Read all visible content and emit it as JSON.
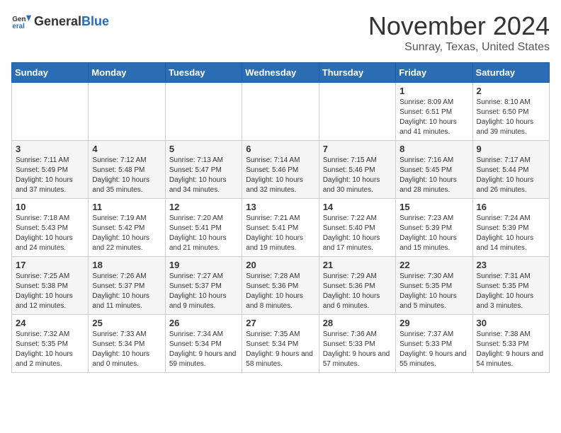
{
  "header": {
    "logo_general": "General",
    "logo_blue": "Blue",
    "month_title": "November 2024",
    "location": "Sunray, Texas, United States"
  },
  "days_of_week": [
    "Sunday",
    "Monday",
    "Tuesday",
    "Wednesday",
    "Thursday",
    "Friday",
    "Saturday"
  ],
  "weeks": [
    [
      {
        "day": "",
        "info": ""
      },
      {
        "day": "",
        "info": ""
      },
      {
        "day": "",
        "info": ""
      },
      {
        "day": "",
        "info": ""
      },
      {
        "day": "",
        "info": ""
      },
      {
        "day": "1",
        "info": "Sunrise: 8:09 AM\nSunset: 6:51 PM\nDaylight: 10 hours and 41 minutes."
      },
      {
        "day": "2",
        "info": "Sunrise: 8:10 AM\nSunset: 6:50 PM\nDaylight: 10 hours and 39 minutes."
      }
    ],
    [
      {
        "day": "3",
        "info": "Sunrise: 7:11 AM\nSunset: 5:49 PM\nDaylight: 10 hours and 37 minutes."
      },
      {
        "day": "4",
        "info": "Sunrise: 7:12 AM\nSunset: 5:48 PM\nDaylight: 10 hours and 35 minutes."
      },
      {
        "day": "5",
        "info": "Sunrise: 7:13 AM\nSunset: 5:47 PM\nDaylight: 10 hours and 34 minutes."
      },
      {
        "day": "6",
        "info": "Sunrise: 7:14 AM\nSunset: 5:46 PM\nDaylight: 10 hours and 32 minutes."
      },
      {
        "day": "7",
        "info": "Sunrise: 7:15 AM\nSunset: 5:46 PM\nDaylight: 10 hours and 30 minutes."
      },
      {
        "day": "8",
        "info": "Sunrise: 7:16 AM\nSunset: 5:45 PM\nDaylight: 10 hours and 28 minutes."
      },
      {
        "day": "9",
        "info": "Sunrise: 7:17 AM\nSunset: 5:44 PM\nDaylight: 10 hours and 26 minutes."
      }
    ],
    [
      {
        "day": "10",
        "info": "Sunrise: 7:18 AM\nSunset: 5:43 PM\nDaylight: 10 hours and 24 minutes."
      },
      {
        "day": "11",
        "info": "Sunrise: 7:19 AM\nSunset: 5:42 PM\nDaylight: 10 hours and 22 minutes."
      },
      {
        "day": "12",
        "info": "Sunrise: 7:20 AM\nSunset: 5:41 PM\nDaylight: 10 hours and 21 minutes."
      },
      {
        "day": "13",
        "info": "Sunrise: 7:21 AM\nSunset: 5:41 PM\nDaylight: 10 hours and 19 minutes."
      },
      {
        "day": "14",
        "info": "Sunrise: 7:22 AM\nSunset: 5:40 PM\nDaylight: 10 hours and 17 minutes."
      },
      {
        "day": "15",
        "info": "Sunrise: 7:23 AM\nSunset: 5:39 PM\nDaylight: 10 hours and 15 minutes."
      },
      {
        "day": "16",
        "info": "Sunrise: 7:24 AM\nSunset: 5:39 PM\nDaylight: 10 hours and 14 minutes."
      }
    ],
    [
      {
        "day": "17",
        "info": "Sunrise: 7:25 AM\nSunset: 5:38 PM\nDaylight: 10 hours and 12 minutes."
      },
      {
        "day": "18",
        "info": "Sunrise: 7:26 AM\nSunset: 5:37 PM\nDaylight: 10 hours and 11 minutes."
      },
      {
        "day": "19",
        "info": "Sunrise: 7:27 AM\nSunset: 5:37 PM\nDaylight: 10 hours and 9 minutes."
      },
      {
        "day": "20",
        "info": "Sunrise: 7:28 AM\nSunset: 5:36 PM\nDaylight: 10 hours and 8 minutes."
      },
      {
        "day": "21",
        "info": "Sunrise: 7:29 AM\nSunset: 5:36 PM\nDaylight: 10 hours and 6 minutes."
      },
      {
        "day": "22",
        "info": "Sunrise: 7:30 AM\nSunset: 5:35 PM\nDaylight: 10 hours and 5 minutes."
      },
      {
        "day": "23",
        "info": "Sunrise: 7:31 AM\nSunset: 5:35 PM\nDaylight: 10 hours and 3 minutes."
      }
    ],
    [
      {
        "day": "24",
        "info": "Sunrise: 7:32 AM\nSunset: 5:35 PM\nDaylight: 10 hours and 2 minutes."
      },
      {
        "day": "25",
        "info": "Sunrise: 7:33 AM\nSunset: 5:34 PM\nDaylight: 10 hours and 0 minutes."
      },
      {
        "day": "26",
        "info": "Sunrise: 7:34 AM\nSunset: 5:34 PM\nDaylight: 9 hours and 59 minutes."
      },
      {
        "day": "27",
        "info": "Sunrise: 7:35 AM\nSunset: 5:34 PM\nDaylight: 9 hours and 58 minutes."
      },
      {
        "day": "28",
        "info": "Sunrise: 7:36 AM\nSunset: 5:33 PM\nDaylight: 9 hours and 57 minutes."
      },
      {
        "day": "29",
        "info": "Sunrise: 7:37 AM\nSunset: 5:33 PM\nDaylight: 9 hours and 55 minutes."
      },
      {
        "day": "30",
        "info": "Sunrise: 7:38 AM\nSunset: 5:33 PM\nDaylight: 9 hours and 54 minutes."
      }
    ]
  ]
}
